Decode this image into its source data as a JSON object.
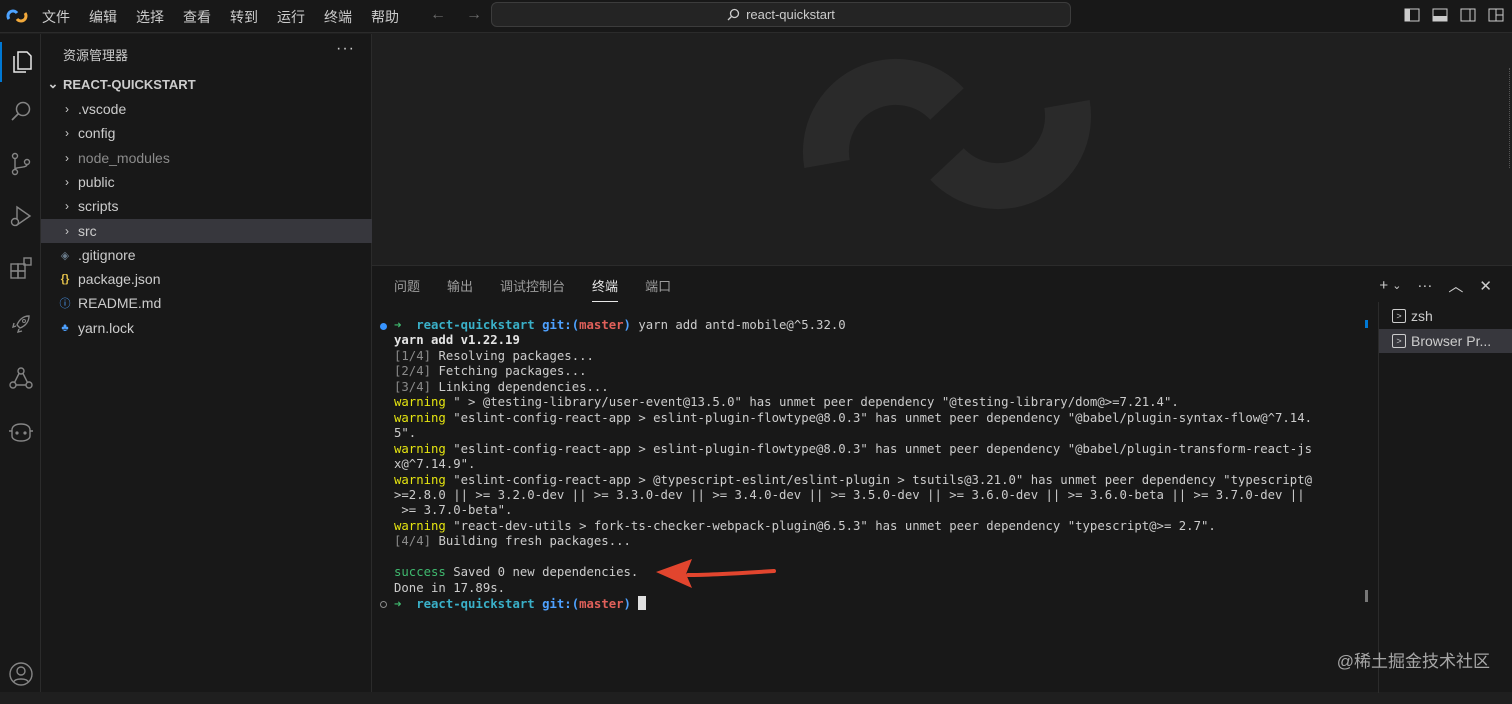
{
  "menu": [
    "文件",
    "编辑",
    "选择",
    "查看",
    "转到",
    "运行",
    "终端",
    "帮助"
  ],
  "command_center": {
    "label": "react-quickstart"
  },
  "sidebar": {
    "title": "资源管理器",
    "more": "···",
    "root": "REACT-QUICKSTART",
    "items": [
      {
        "label": ".vscode",
        "kind": "folder"
      },
      {
        "label": "config",
        "kind": "folder"
      },
      {
        "label": "node_modules",
        "kind": "folder"
      },
      {
        "label": "public",
        "kind": "folder"
      },
      {
        "label": "scripts",
        "kind": "folder"
      },
      {
        "label": "src",
        "kind": "folder"
      },
      {
        "label": ".gitignore",
        "kind": "file",
        "icon": "gitignore-icon"
      },
      {
        "label": "package.json",
        "kind": "file",
        "icon": "json-icon"
      },
      {
        "label": "README.md",
        "kind": "file",
        "icon": "info-icon"
      },
      {
        "label": "yarn.lock",
        "kind": "file",
        "icon": "yarn-icon"
      }
    ]
  },
  "panel": {
    "tabs": [
      "问题",
      "输出",
      "调试控制台",
      "终端",
      "端口"
    ],
    "active_tab": "终端"
  },
  "terminal": {
    "prompt_arrow": "➜",
    "dir": "react-quickstart",
    "git_prefix": "git:(",
    "branch": "master",
    "git_suffix": ")",
    "command": "yarn add antd-mobile@^5.32.0",
    "version_line": "yarn add v1.22.19",
    "steps": [
      {
        "tag": "[1/4]",
        "text": "Resolving packages..."
      },
      {
        "tag": "[2/4]",
        "text": "Fetching packages..."
      },
      {
        "tag": "[3/4]",
        "text": "Linking dependencies..."
      }
    ],
    "warning_label": "warning",
    "warnings": [
      [
        " \" > @testing-library/user-event@13.5.0\" has unmet peer dependency \"@testing-library/dom@>=7.21.4\"."
      ],
      [
        " \"eslint-config-react-app > eslint-plugin-flowtype@8.0.3\" has unmet peer dependency \"@babel/plugin-syntax-flow@^7.14.",
        "5\"."
      ],
      [
        " \"eslint-config-react-app > eslint-plugin-flowtype@8.0.3\" has unmet peer dependency \"@babel/plugin-transform-react-js",
        "x@^7.14.9\"."
      ],
      [
        " \"eslint-config-react-app > @typescript-eslint/eslint-plugin > tsutils@3.21.0\" has unmet peer dependency \"typescript@",
        ">=2.8.0 || >= 3.2.0-dev || >= 3.3.0-dev || >= 3.4.0-dev || >= 3.5.0-dev || >= 3.6.0-dev || >= 3.6.0-beta || >= 3.7.0-dev ||",
        " >= 3.7.0-beta\"."
      ],
      [
        " \"react-dev-utils > fork-ts-checker-webpack-plugin@6.5.3\" has unmet peer dependency \"typescript@>= 2.7\"."
      ]
    ],
    "step4": {
      "tag": "[4/4]",
      "text": "Building fresh packages..."
    },
    "success_label": "success",
    "success_text": " Saved 0 new dependencies.",
    "done": "Done in 17.89s."
  },
  "terminal_list": [
    {
      "label": "zsh"
    },
    {
      "label": "Browser Pr..."
    }
  ],
  "watermark": "@稀土掘金技术社区",
  "colors": {
    "accent": "#0078d4",
    "annotation_arrow": "#e2452e",
    "terminal_success": "#3fb86e"
  }
}
